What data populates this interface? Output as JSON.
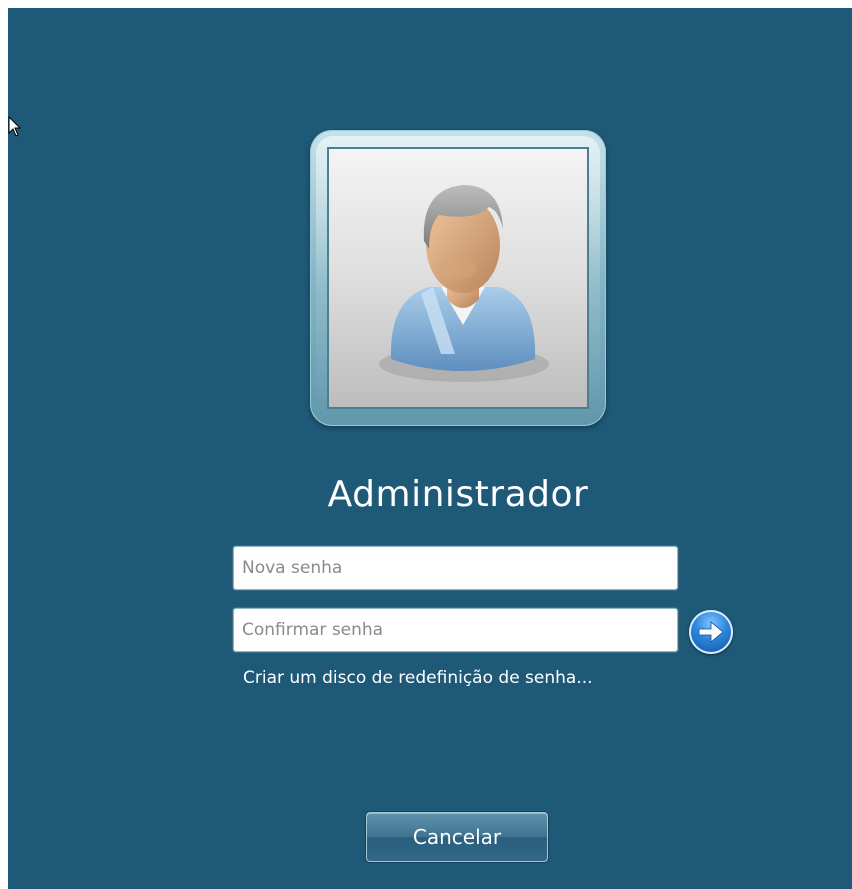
{
  "user": {
    "name": "Administrador",
    "avatar_icon": "user-avatar-icon"
  },
  "form": {
    "new_password_placeholder": "Nova senha",
    "confirm_password_placeholder": "Confirmar senha",
    "submit_icon": "arrow-right-icon",
    "reset_disk_link": "Criar um disco de redefinição de senha..."
  },
  "actions": {
    "cancel_label": "Cancelar"
  },
  "colors": {
    "background": "#1e5a78",
    "submit_accent": "#2a84d8"
  }
}
